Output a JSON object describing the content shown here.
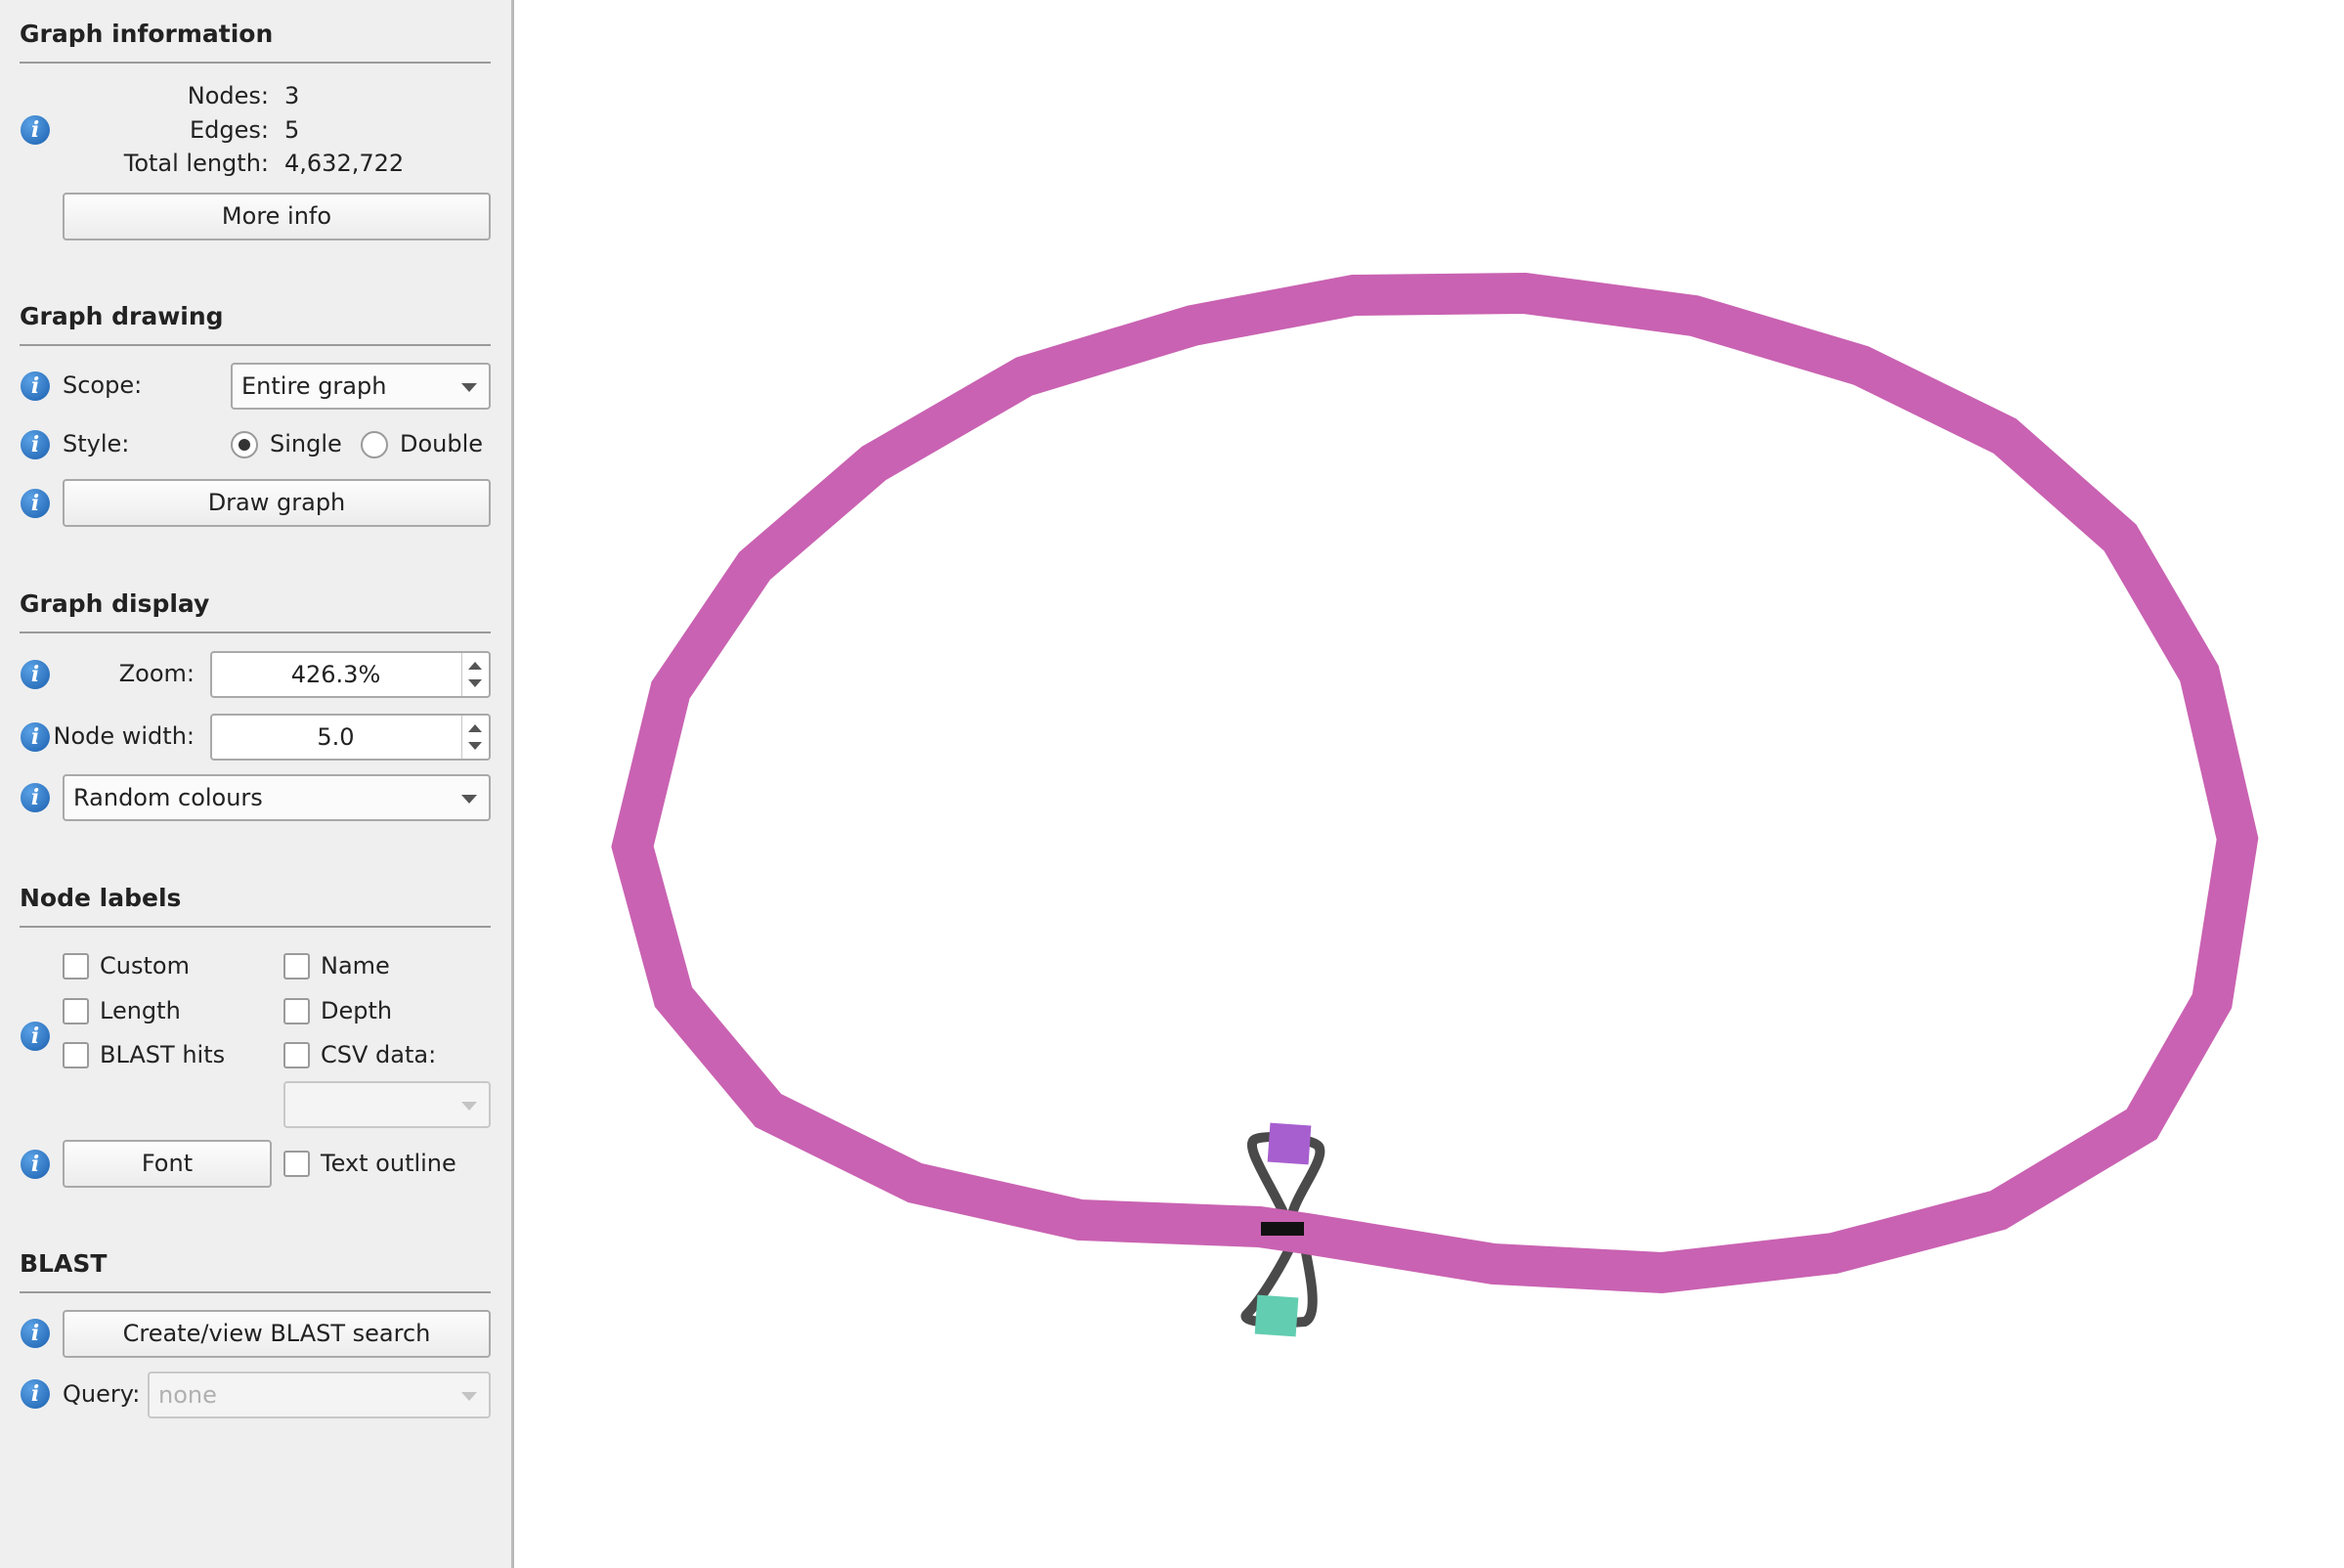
{
  "graph_information": {
    "title": "Graph information",
    "nodes_label": "Nodes:",
    "nodes_value": "3",
    "edges_label": "Edges:",
    "edges_value": "5",
    "total_length_label": "Total length:",
    "total_length_value": "4,632,722",
    "more_info_button": "More info"
  },
  "graph_drawing": {
    "title": "Graph drawing",
    "scope_label": "Scope:",
    "scope_value": "Entire graph",
    "style_label": "Style:",
    "style_single": "Single",
    "style_double": "Double",
    "style_selected": "Single",
    "draw_button": "Draw graph"
  },
  "graph_display": {
    "title": "Graph display",
    "zoom_label": "Zoom:",
    "zoom_value": "426.3%",
    "node_width_label": "Node width:",
    "node_width_value": "5.0",
    "colour_scheme": "Random colours"
  },
  "node_labels": {
    "title": "Node labels",
    "custom": "Custom",
    "name": "Name",
    "length": "Length",
    "depth": "Depth",
    "blast_hits": "BLAST hits",
    "csv_data": "CSV data:",
    "csv_value": "",
    "font_button": "Font",
    "text_outline": "Text outline"
  },
  "blast": {
    "title": "BLAST",
    "search_button": "Create/view BLAST search",
    "query_label": "Query:",
    "query_value": "none"
  },
  "colors": {
    "loop_node": "#c962b2",
    "node_purple": "#a75fcf",
    "node_teal": "#62cdb1",
    "edge": "#4a4a4a"
  },
  "icons": [
    "info-icon",
    "dropdown-arrow-icon",
    "spin-up-icon",
    "spin-down-icon"
  ]
}
